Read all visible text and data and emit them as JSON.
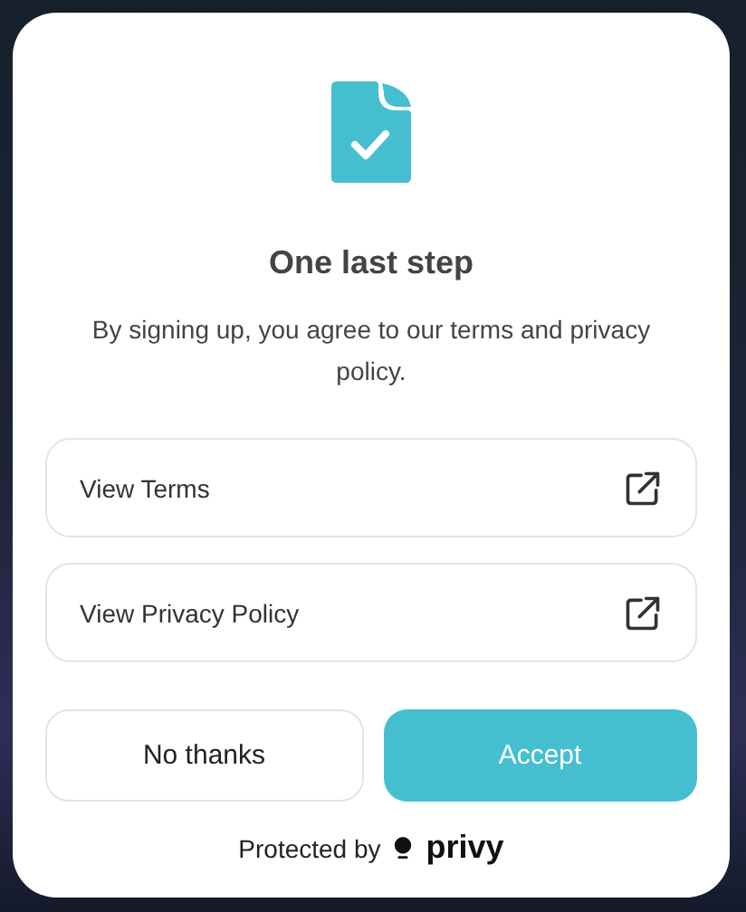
{
  "dialog": {
    "title": "One last step",
    "description": "By signing up, you agree to our terms and privacy policy.",
    "links": [
      {
        "label": "View Terms"
      },
      {
        "label": "View Privacy Policy"
      }
    ],
    "buttons": [
      {
        "label": "No thanks",
        "kind": "secondary"
      },
      {
        "label": "Accept",
        "kind": "primary"
      }
    ],
    "footer": {
      "text": "Protected by",
      "brand": "privy"
    }
  }
}
